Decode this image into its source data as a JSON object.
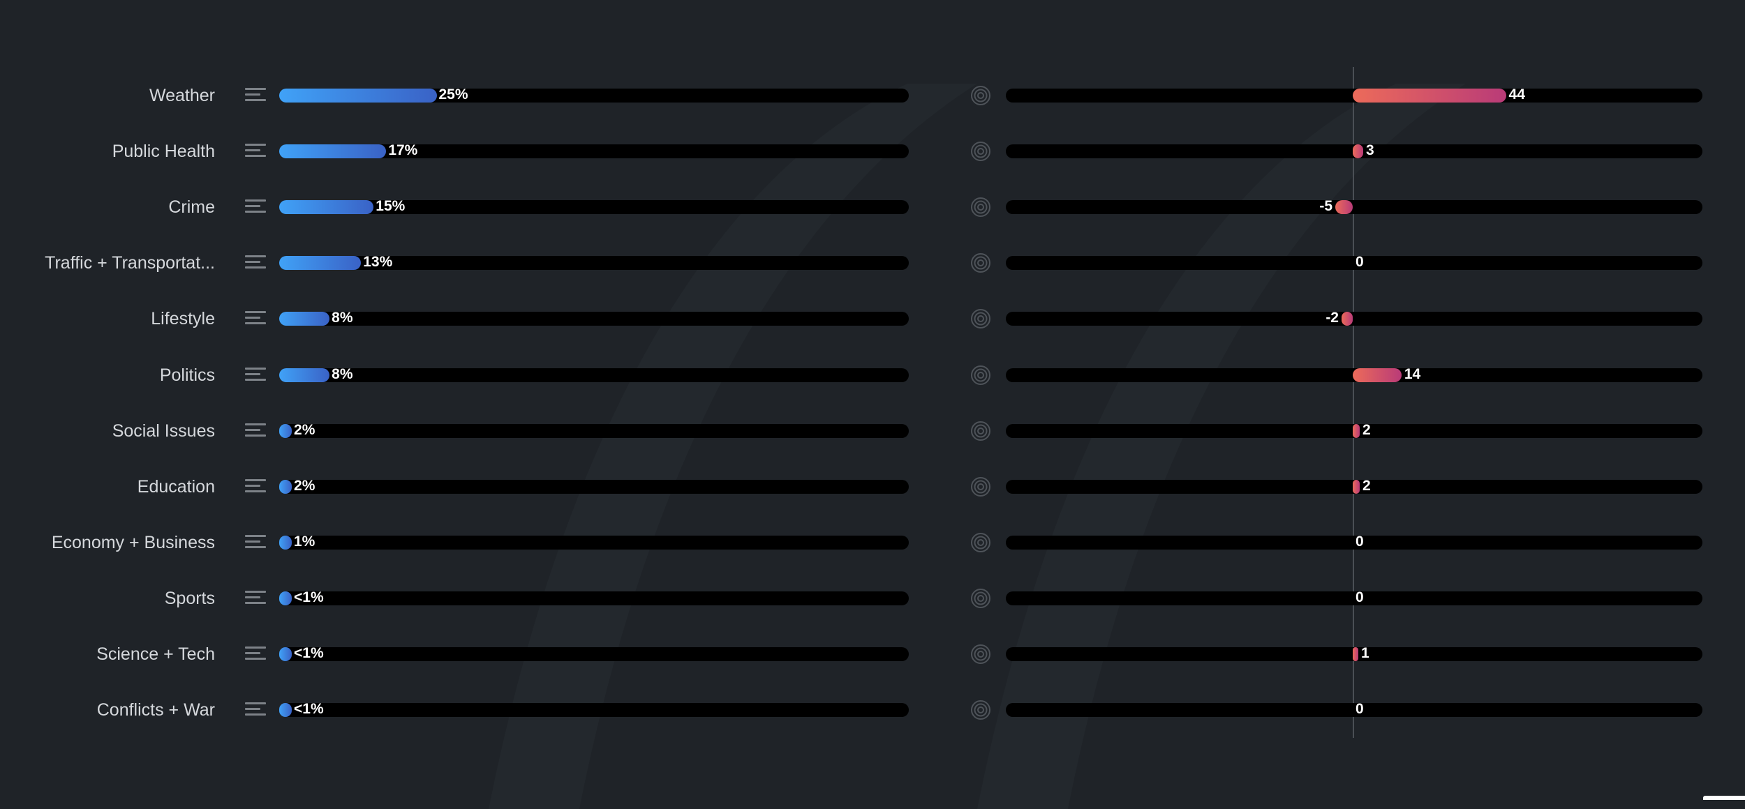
{
  "chart_data": [
    {
      "type": "bar",
      "orientation": "horizontal",
      "title": "",
      "categories": [
        "Weather",
        "Public Health",
        "Crime",
        "Traffic + Transportat...",
        "Lifestyle",
        "Politics",
        "Social Issues",
        "Education",
        "Economy + Business",
        "Sports",
        "Science + Tech",
        "Conflicts + War"
      ],
      "values": [
        25,
        17,
        15,
        13,
        8,
        8,
        2,
        2,
        1,
        0.5,
        0.5,
        0.5
      ],
      "value_labels": [
        "25%",
        "17%",
        "15%",
        "13%",
        "8%",
        "8%",
        "2%",
        "2%",
        "1%",
        "<1%",
        "<1%",
        "<1%"
      ],
      "xlim": [
        0,
        100
      ],
      "color": "#3f8ff0"
    },
    {
      "type": "bar",
      "orientation": "horizontal-diverging",
      "title": "",
      "categories": [
        "Weather",
        "Public Health",
        "Crime",
        "Traffic + Transportat...",
        "Lifestyle",
        "Politics",
        "Social Issues",
        "Education",
        "Economy + Business",
        "Sports",
        "Science + Tech",
        "Conflicts + War"
      ],
      "values": [
        44,
        3,
        -5,
        0,
        -2,
        14,
        2,
        2,
        0,
        0,
        1,
        0
      ],
      "value_labels": [
        "44",
        "3",
        "-5",
        "0",
        "-2",
        "14",
        "2",
        "2",
        "0",
        "0",
        "1",
        "0"
      ],
      "xlim": [
        -100,
        100
      ],
      "color": "#e8655a"
    }
  ]
}
